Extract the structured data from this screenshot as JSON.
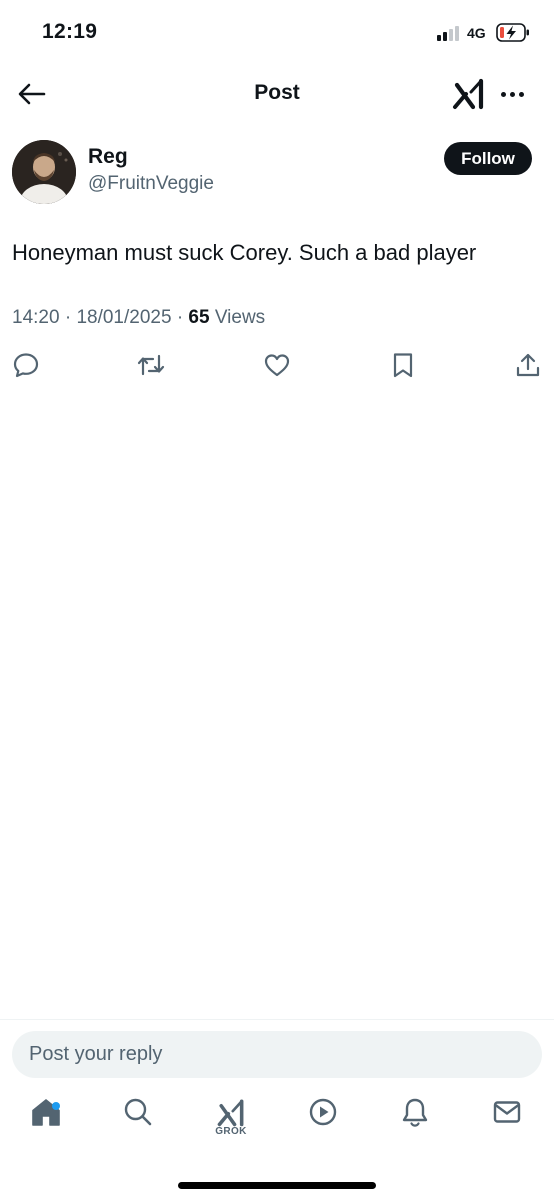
{
  "status_bar": {
    "time": "12:19",
    "network": "4G"
  },
  "header": {
    "title": "Post"
  },
  "post": {
    "author_name": "Reg",
    "author_handle": "@FruitnVeggie",
    "follow_label": "Follow",
    "text": "Honeyman must suck Corey. Such a bad player",
    "time": "14:20",
    "separator": "·",
    "date": "18/01/2025",
    "views_count": "65",
    "views_label": "Views"
  },
  "reply": {
    "placeholder": "Post your reply"
  },
  "tabbar": {
    "grok_label": "GROK"
  },
  "colors": {
    "accent": "#1d9bf0",
    "text": "#0f1419",
    "secondary": "#536471",
    "input_bg": "#eff3f4",
    "battery_low": "#eb4d3d"
  },
  "icons": [
    "back-arrow-icon",
    "grok-icon",
    "more-icon",
    "reply-icon",
    "repost-icon",
    "like-icon",
    "bookmark-icon",
    "share-icon",
    "home-icon",
    "search-icon",
    "play-icon",
    "bell-icon",
    "mail-icon"
  ]
}
